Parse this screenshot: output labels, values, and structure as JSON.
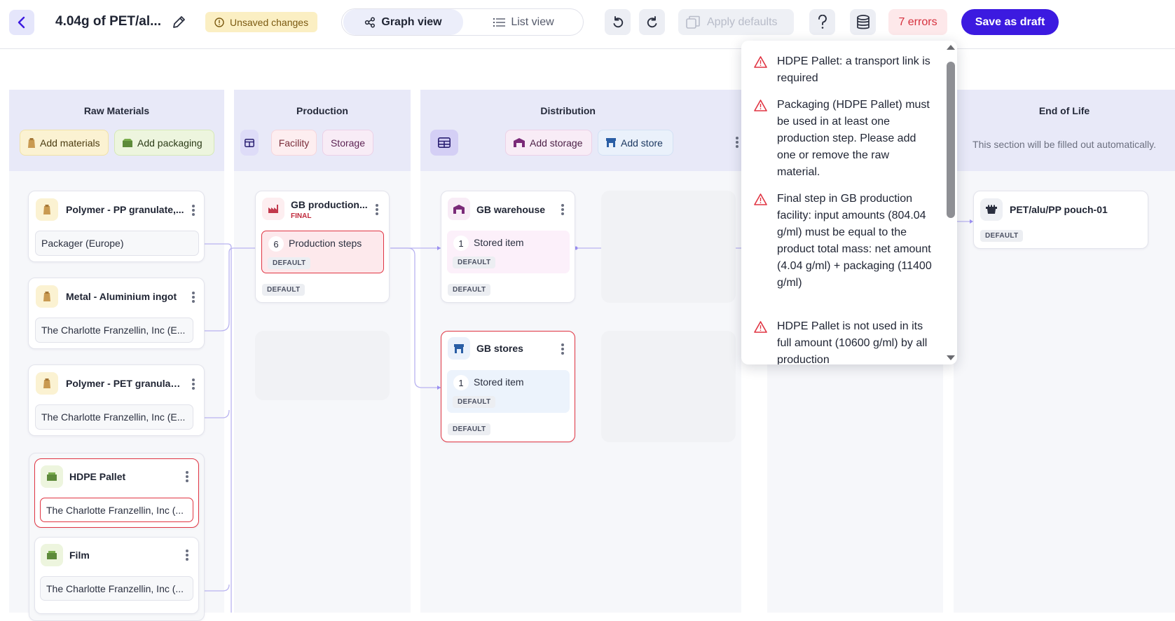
{
  "header": {
    "title": "4.04g of PET/al...",
    "unsaved_label": "Unsaved changes",
    "graph_view_label": "Graph view",
    "list_view_label": "List view",
    "apply_defaults_label": "Apply defaults",
    "errors_label": "7 errors",
    "save_draft_label": "Save as draft"
  },
  "columns": {
    "raw_materials": {
      "title": "Raw Materials",
      "add_materials": "Add materials",
      "add_packaging": "Add packaging"
    },
    "production": {
      "title": "Production",
      "facility": "Facility",
      "storage": "Storage"
    },
    "distribution": {
      "title": "Distribution",
      "add_storage": "Add storage",
      "add_store": "Add store"
    },
    "end_of_life": {
      "title": "End of Life",
      "note": "This section will be filled out automatically."
    }
  },
  "raw_cards": [
    {
      "title": "Polymer - PP granulate,...",
      "supplier": "Packager (Europe)"
    },
    {
      "title": "Metal - Aluminium ingot",
      "supplier": "The Charlotte Franzellin, Inc (E..."
    },
    {
      "title": "Polymer - PET granulat...",
      "supplier": "The Charlotte Franzellin, Inc (E..."
    },
    {
      "title": "HDPE Pallet",
      "supplier": "The Charlotte Franzellin, Inc (..."
    },
    {
      "title": "Film",
      "supplier": "The Charlotte Franzellin, Inc (..."
    }
  ],
  "production_card": {
    "title": "GB production...",
    "final_tag": "FINAL",
    "steps_count": "6",
    "steps_label": "Production steps",
    "inner_tag": "DEFAULT",
    "outer_tag": "DEFAULT"
  },
  "distribution_cards": [
    {
      "title": "GB warehouse",
      "count": "1",
      "label": "Stored item",
      "inner_tag": "DEFAULT",
      "outer_tag": "DEFAULT"
    },
    {
      "title": "GB stores",
      "count": "1",
      "label": "Stored item",
      "inner_tag": "DEFAULT",
      "outer_tag": "DEFAULT"
    }
  ],
  "eol_card": {
    "title": "PET/alu/PP pouch-01",
    "tag": "DEFAULT"
  },
  "errors": [
    "HDPE Pallet: a transport link is required",
    "Packaging (HDPE Pallet) must be used in at least one production step. Please add one or remove the raw material.",
    "Final step in GB production facility: input amounts (804.04 g/ml) must be equal to the product total mass: net amount (4.04 g/ml) + packaging (11400 g/ml)",
    "HDPE Pallet is not used in its full amount (10600 g/ml) by all production"
  ],
  "colors": {
    "accent": "#3c1ae0",
    "error": "#e03442",
    "column_header": "#e8e9f8"
  }
}
